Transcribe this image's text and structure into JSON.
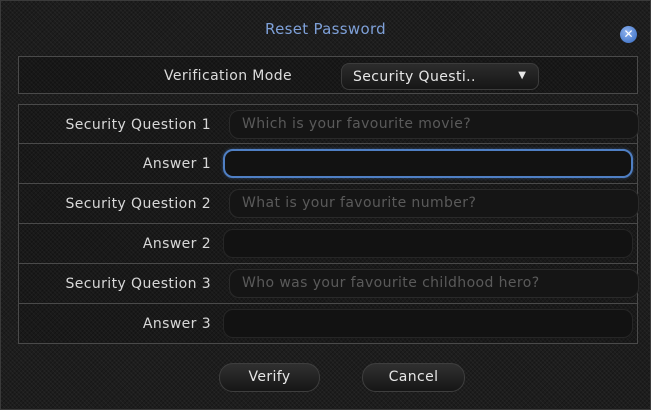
{
  "dialog": {
    "title": "Reset Password",
    "close_icon": "close-icon",
    "accent_color": "#7ea0d8"
  },
  "verification": {
    "label": "Verification Mode",
    "selected": "Security Questi..",
    "arrow_icon": "dropdown-arrow-icon"
  },
  "rows": {
    "q1": {
      "label": "Security Question 1",
      "placeholder": "Which is your favourite movie?"
    },
    "a1": {
      "label": "Answer 1",
      "value": ""
    },
    "q2": {
      "label": "Security Question 2",
      "placeholder": "What is your favourite number?"
    },
    "a2": {
      "label": "Answer 2",
      "value": ""
    },
    "q3": {
      "label": "Security Question 3",
      "placeholder": "Who was your favourite childhood hero?"
    },
    "a3": {
      "label": "Answer 3",
      "value": ""
    }
  },
  "buttons": {
    "verify": "Verify",
    "cancel": "Cancel"
  }
}
